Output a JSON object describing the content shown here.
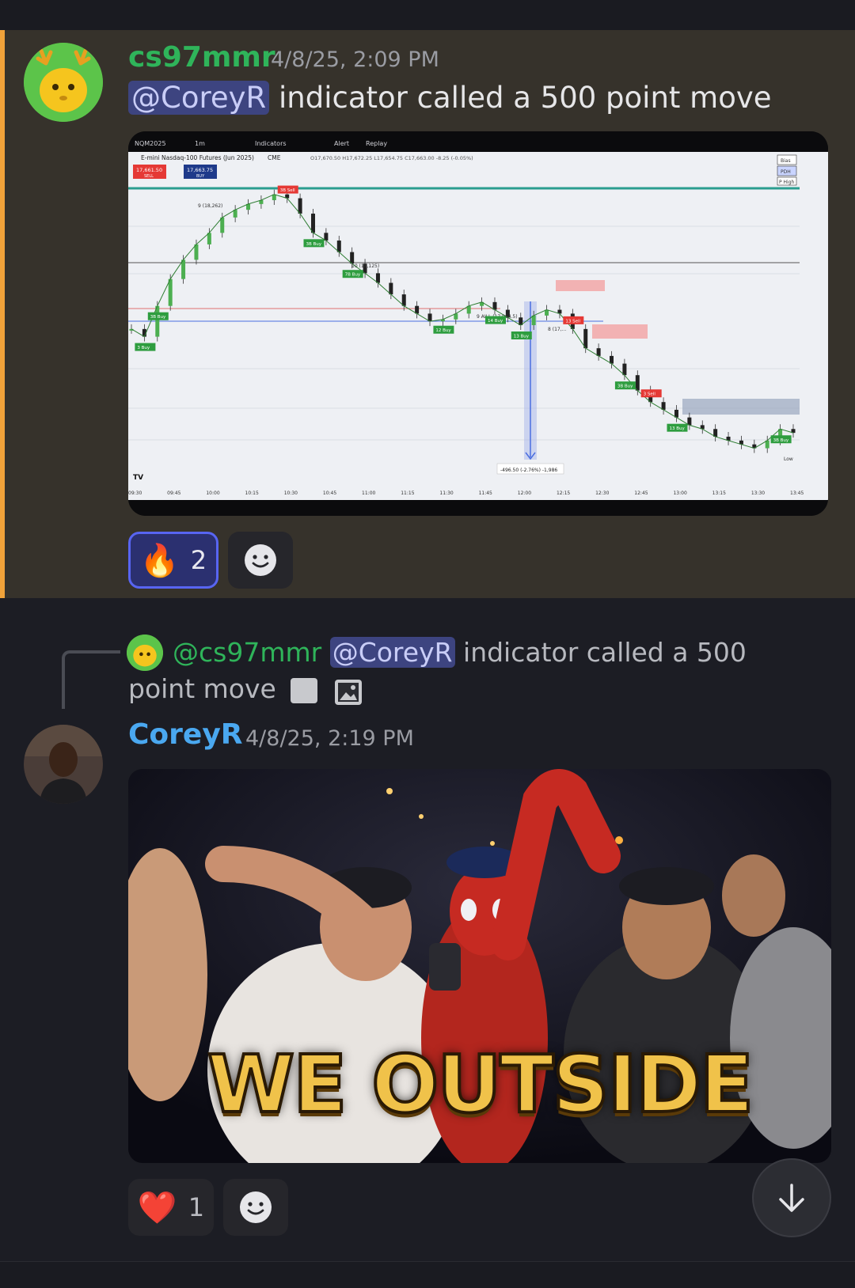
{
  "messages": [
    {
      "username": "cs97mmr",
      "timestamp": "4/8/25, 2:09 PM",
      "mention": "@CoreyR",
      "text": "indicator called a 500 point move",
      "user_color": "#2fb45a",
      "reactions": [
        {
          "emoji": "🔥",
          "icon": "fire-emoji",
          "count": "2",
          "active": true
        }
      ],
      "attachment": {
        "type": "chart-screenshot",
        "chart_data": {
          "type": "line",
          "title": "E-mini Nasdaq-100 Futures (Jun 2025)",
          "symbol": "NQM2025",
          "interval": "1m",
          "exchange": "CME",
          "ohlc_text": "O17,670.50 H17,672.25 L17,654.75 C17,663.00 -8.25 (-0.05%)",
          "sell_price": "17,661.50",
          "sell_label": "SELL",
          "buy_price": "17,663.75",
          "buy_label": "BUY",
          "toolbar": [
            "NQM2025",
            "1m",
            "Indicators",
            "Alert",
            "Replay"
          ],
          "x_tick_labels": [
            "09:30",
            "09:45",
            "10:00",
            "10:15",
            "10:30",
            "10:45",
            "11:00",
            "11:15",
            "11:30",
            "11:45",
            "12:00",
            "12:15",
            "12:30",
            "12:45",
            "13:00",
            "13:15",
            "13:30",
            "13:45"
          ],
          "x": [
            "09:30",
            "09:35",
            "09:40",
            "09:45",
            "09:50",
            "09:55",
            "10:00",
            "10:05",
            "10:10",
            "10:15",
            "10:20",
            "10:25",
            "10:30",
            "10:35",
            "10:40",
            "10:45",
            "10:50",
            "10:55",
            "11:00",
            "11:05",
            "11:10",
            "11:15",
            "11:20",
            "11:25",
            "11:30",
            "11:35",
            "11:40",
            "11:45",
            "11:50",
            "11:55",
            "12:00",
            "12:05",
            "12:10",
            "12:15",
            "12:20",
            "12:25",
            "12:30",
            "12:35",
            "12:40",
            "12:45",
            "12:50",
            "12:55",
            "13:00",
            "13:05",
            "13:10",
            "13:15",
            "13:20",
            "13:25",
            "13:30",
            "13:35",
            "13:40",
            "13:45"
          ],
          "series": [
            {
              "values": [
                17950,
                17930,
                18010,
                18080,
                18130,
                18170,
                18200,
                18240,
                18260,
                18275,
                18285,
                18300,
                18290,
                18250,
                18200,
                18180,
                18150,
                18120,
                18095,
                18070,
                18040,
                18010,
                17990,
                17970,
                17975,
                17990,
                18010,
                18020,
                18000,
                17980,
                17960,
                17985,
                18000,
                17990,
                17950,
                17900,
                17880,
                17860,
                17830,
                17790,
                17760,
                17740,
                17720,
                17700,
                17690,
                17670,
                17660,
                17650,
                17640,
                17660,
                17690,
                17680
              ]
            }
          ],
          "annotations": {
            "levels": [
              "9 (18,262)",
              "10 (18,125)",
              "9 AILL (17,964.5)",
              "8 (17,..."
            ],
            "signals": [
              "3B Sell",
              "3B Buy",
              "7B Buy",
              "3 Buy",
              "3B Buy",
              "12 Buy",
              "14 Buy",
              "13 Buy",
              "13 Sell",
              "3 Sell",
              "3B Buy",
              "13 Buy",
              "3B Buy"
            ],
            "measure_label": "-496.50 (-2.76%) -1,986",
            "side_labels": [
              "Bias",
              "PDH",
              "P High",
              "Low"
            ]
          }
        }
      }
    },
    {
      "username": "CoreyR",
      "timestamp": "4/8/25, 2:19 PM",
      "user_color": "#4aa8f0",
      "reply_to": {
        "username": "@cs97mmr",
        "mention": "@CoreyR",
        "text": "indicator called a 500 point move"
      },
      "attachment": {
        "type": "gif",
        "caption": "WE OUTSIDE"
      },
      "reactions": [
        {
          "emoji": "❤️",
          "icon": "heart-emoji",
          "count": "1",
          "active": false
        }
      ]
    }
  ],
  "colors": {
    "highlight_bg": "#36322b",
    "highlight_bar": "#f0a23a",
    "mention_bg": "#3d4480",
    "mention_text": "#c9cdf7",
    "blurple": "#5865f2"
  }
}
